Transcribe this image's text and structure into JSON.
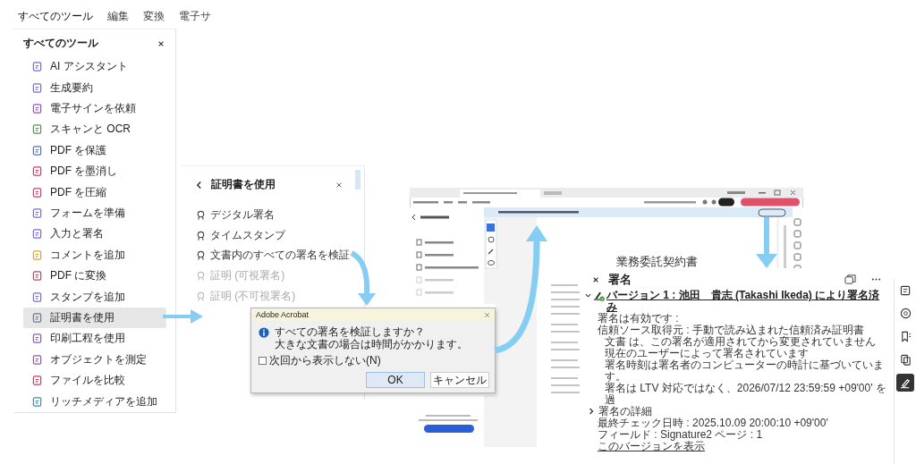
{
  "top_tabs": [
    {
      "label": "すべてのツール",
      "selected": true
    },
    {
      "label": "編集",
      "selected": false
    },
    {
      "label": "変換",
      "selected": false
    },
    {
      "label": "電子サ",
      "selected": false
    }
  ],
  "all_tools_panel": {
    "title": "すべてのツール",
    "items": [
      {
        "label": "AI アシスタント",
        "selected": false
      },
      {
        "label": "生成要約",
        "selected": false
      },
      {
        "label": "電子サインを依頼",
        "selected": false
      },
      {
        "label": "スキャンと OCR",
        "selected": false
      },
      {
        "label": "PDF を保護",
        "selected": false
      },
      {
        "label": "PDF を墨消し",
        "selected": false
      },
      {
        "label": "PDF を圧縮",
        "selected": false
      },
      {
        "label": "フォームを準備",
        "selected": false
      },
      {
        "label": "入力と署名",
        "selected": false
      },
      {
        "label": "コメントを追加",
        "selected": false
      },
      {
        "label": "PDF に変換",
        "selected": false
      },
      {
        "label": "スタンプを追加",
        "selected": false
      },
      {
        "label": "証明書を使用",
        "selected": true
      },
      {
        "label": "印刷工程を使用",
        "selected": false
      },
      {
        "label": "オブジェクトを測定",
        "selected": false
      },
      {
        "label": "ファイルを比較",
        "selected": false
      },
      {
        "label": "リッチメディアを追加",
        "selected": false
      }
    ]
  },
  "certificate_panel": {
    "title": "証明書を使用",
    "items": [
      {
        "label": "デジタル署名",
        "disabled": false
      },
      {
        "label": "タイムスタンプ",
        "disabled": false
      },
      {
        "label": "文書内のすべての署名を検証",
        "disabled": false
      },
      {
        "label": "証明 (可視署名)",
        "disabled": true
      },
      {
        "label": "証明 (不可視署名)",
        "disabled": true
      }
    ]
  },
  "dialog": {
    "title": "Adobe Acrobat",
    "message": [
      "すべての署名を検証しますか？",
      "大きな文書の場合は時間がかかります。"
    ],
    "checkbox": {
      "label": "次回から表示しない(N)",
      "checked": false
    },
    "buttons": [
      {
        "label": "OK",
        "selected": true
      },
      {
        "label": "キャンセル",
        "selected": false
      }
    ]
  },
  "app_screenshot": {
    "document_title": "業務委託契約書"
  },
  "signature_panel": {
    "title": "署名",
    "signature": {
      "heading": "バージョン 1 : 池田　貴志 (Takashi Ikeda) により署名済み",
      "expanded": true,
      "details": [
        {
          "kind": "text",
          "text": "署名は有効です :"
        },
        {
          "kind": "text",
          "text": "信頼ソース取得元 : 手動で読み込まれた信頼済み証明書",
          "children": [
            {
              "kind": "text",
              "text": "文書 は、この署名が適用されてから変更されていません"
            },
            {
              "kind": "text",
              "text": "現在のユーザーによって署名されています"
            },
            {
              "kind": "text",
              "text": "署名時刻は署名者のコンピューターの時計に基づいています。"
            },
            {
              "kind": "text",
              "text": "署名は LTV 対応ではなく、2026/07/12 23:59:59 +09'00' を過"
            }
          ]
        },
        {
          "kind": "expandable",
          "text": "署名の詳細",
          "expanded": false
        },
        {
          "kind": "text",
          "text": "最終チェック日時 : 2025.10.09 20:00:10 +09'00'"
        },
        {
          "kind": "text",
          "text": "フィールド : Signature2  ページ : 1"
        },
        {
          "kind": "link",
          "text": "このバージョンを表示"
        }
      ]
    }
  },
  "right_toolbar": [
    {
      "selected": false
    },
    {
      "selected": false
    },
    {
      "selected": false
    },
    {
      "selected": false
    },
    {
      "selected": true
    }
  ]
}
